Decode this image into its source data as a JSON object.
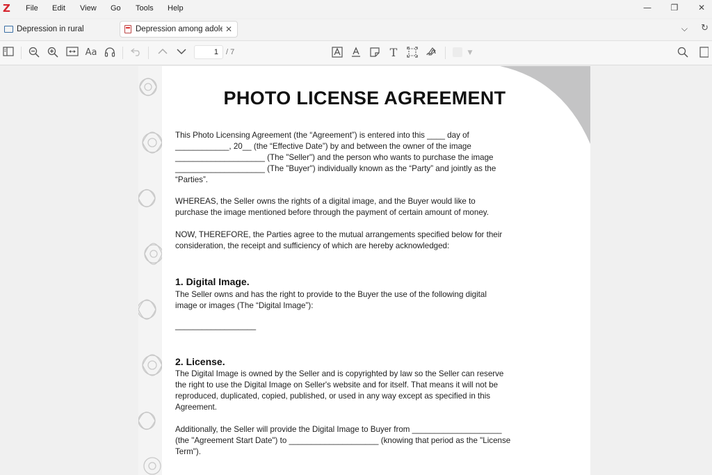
{
  "app": {
    "logo": "Z"
  },
  "menu": {
    "items": [
      "File",
      "Edit",
      "View",
      "Go",
      "Tools",
      "Help"
    ]
  },
  "window_controls": {
    "minimize": "—",
    "restore": "❐",
    "close": "✕"
  },
  "tabs": {
    "library": {
      "label": "Depression in rural"
    },
    "active": {
      "label": "Depression among adolescents",
      "close": "✕"
    },
    "chevron": "⌵",
    "sync": "↻"
  },
  "toolbar": {
    "page_current": "1",
    "page_total": "/ 7",
    "icons": [
      "sidebar-toggle-icon",
      "zoom-out-icon",
      "zoom-in-icon",
      "fit-width-icon",
      "text-size-icon",
      "headphones-icon",
      "undo-icon",
      "prev-page-icon",
      "next-page-icon",
      "highlight-text-icon",
      "underline-text-icon",
      "note-icon",
      "add-text-icon",
      "area-select-icon",
      "ink-icon",
      "color-picker-icon",
      "search-icon",
      "context-pane-icon"
    ]
  },
  "document": {
    "title": "PHOTO LICENSE AGREEMENT",
    "p1": "This Photo Licensing Agreement (the “Agreement”) is entered into this ____ day of\n____________, 20__ (the “Effective Date”) by and between the owner of the image\n____________________ (The \"Seller\") and the person who wants to purchase the image\n____________________ (The \"Buyer\") individually known as the “Party” and jointly as the\n“Parties”.",
    "p2": "WHEREAS, the Seller owns the rights of a digital image, and the Buyer would like to\npurchase the image mentioned before through the payment of certain amount of money.",
    "p3": "NOW, THEREFORE, the Parties agree to the mutual arrangements specified below for their\nconsideration, the receipt and sufficiency of which are hereby acknowledged:",
    "h1": "1. Digital Image.",
    "p4": "The Seller owns and has the right to provide to the Buyer the use of the following digital\nimage or images (The “Digital Image”):",
    "blank_line": "__________________",
    "h2": "2. License.",
    "p5": "The Digital Image is owned by the Seller and is copyrighted by law so the Seller can reserve\nthe right to use the Digital Image on Seller's website and for itself. That means it will not be\nreproduced, duplicated, copied, published, or used in any way except as specified in this\nAgreement.",
    "p6": "Additionally, the Seller will provide the Digital Image to Buyer from ____________________\n(the \"Agreement Start Date\") to ____________________ (knowing that period as the \"License\nTerm\")."
  },
  "colors": {
    "accent": "#d6262f",
    "corner": "#c4c4c5"
  }
}
